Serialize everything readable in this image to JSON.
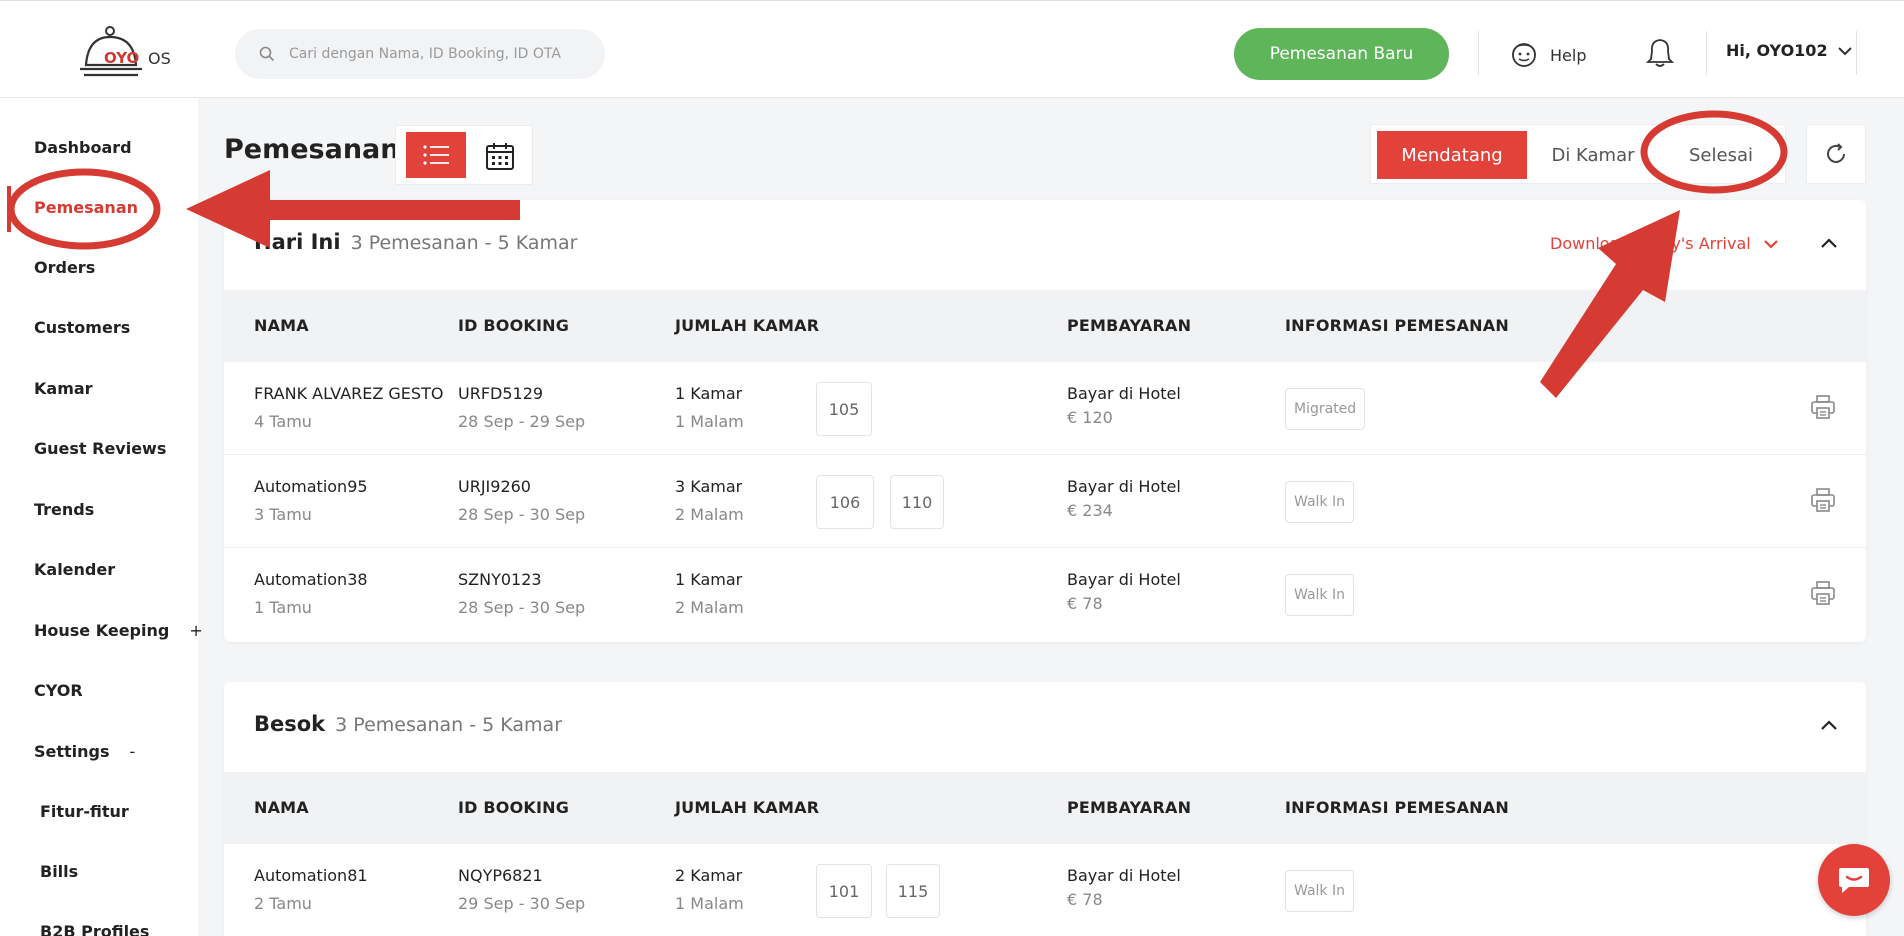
{
  "header": {
    "logo_text": "OYO",
    "logo_suffix": "OS",
    "search_placeholder": "Cari dengan Nama, ID Booking, ID OTA",
    "new_booking_label": "Pemesanan Baru",
    "help_label": "Help",
    "user_label": "Hi, OYO102"
  },
  "sidebar": {
    "items": [
      {
        "label": "Dashboard"
      },
      {
        "label": "Pemesanan"
      },
      {
        "label": "Orders"
      },
      {
        "label": "Customers"
      },
      {
        "label": "Kamar"
      },
      {
        "label": "Guest Reviews"
      },
      {
        "label": "Trends"
      },
      {
        "label": "Kalender"
      },
      {
        "label": "House Keeping",
        "symbol": "+"
      },
      {
        "label": "CYOR"
      },
      {
        "label": "Settings",
        "symbol": "-"
      },
      {
        "label": "Fitur-fitur"
      },
      {
        "label": "Bills"
      },
      {
        "label": "B2B Profiles"
      }
    ]
  },
  "main": {
    "title": "Pemesanan",
    "tabs": [
      {
        "label": "Mendatang",
        "active": true
      },
      {
        "label": "Di Kamar",
        "active": false
      },
      {
        "label": "Selesai",
        "active": false
      }
    ],
    "columns": {
      "name": "NAMA",
      "booking_id": "ID BOOKING",
      "rooms": "JUMLAH KAMAR",
      "payment": "PEMBAYARAN",
      "info": "INFORMASI PEMESANAN"
    },
    "sections": [
      {
        "title": "Hari Ini",
        "summary": "3 Pemesanan - 5 Kamar",
        "download_label": "Download Today's Arrival",
        "rows": [
          {
            "name": "FRANK ALVAREZ GESTO",
            "guests": "4 Tamu",
            "booking_id": "URFD5129",
            "dates": "28 Sep - 29 Sep",
            "rooms": "1 Kamar",
            "nights": "1 Malam",
            "room_numbers": [
              "105"
            ],
            "payment": "Bayar di Hotel",
            "amount": "€ 120",
            "tag": "Migrated"
          },
          {
            "name": "Automation95",
            "guests": "3 Tamu",
            "booking_id": "URJI9260",
            "dates": "28 Sep - 30 Sep",
            "rooms": "3 Kamar",
            "nights": "2 Malam",
            "room_numbers": [
              "106",
              "110"
            ],
            "payment": "Bayar di Hotel",
            "amount": "€ 234",
            "tag": "Walk In"
          },
          {
            "name": "Automation38",
            "guests": "1 Tamu",
            "booking_id": "SZNY0123",
            "dates": "28 Sep - 30 Sep",
            "rooms": "1 Kamar",
            "nights": "2 Malam",
            "room_numbers": [],
            "payment": "Bayar di Hotel",
            "amount": "€ 78",
            "tag": "Walk In"
          }
        ]
      },
      {
        "title": "Besok",
        "summary": "3 Pemesanan - 5 Kamar",
        "rows": [
          {
            "name": "Automation81",
            "guests": "2 Tamu",
            "booking_id": "NQYP6821",
            "dates": "29 Sep - 30 Sep",
            "rooms": "2 Kamar",
            "nights": "1 Malam",
            "room_numbers": [
              "101",
              "115"
            ],
            "payment": "Bayar di Hotel",
            "amount": "€ 78",
            "tag": "Walk In"
          }
        ]
      }
    ]
  },
  "colors": {
    "accent": "#e3423a",
    "green": "#5fb55a",
    "annotation": "#d63b33"
  }
}
